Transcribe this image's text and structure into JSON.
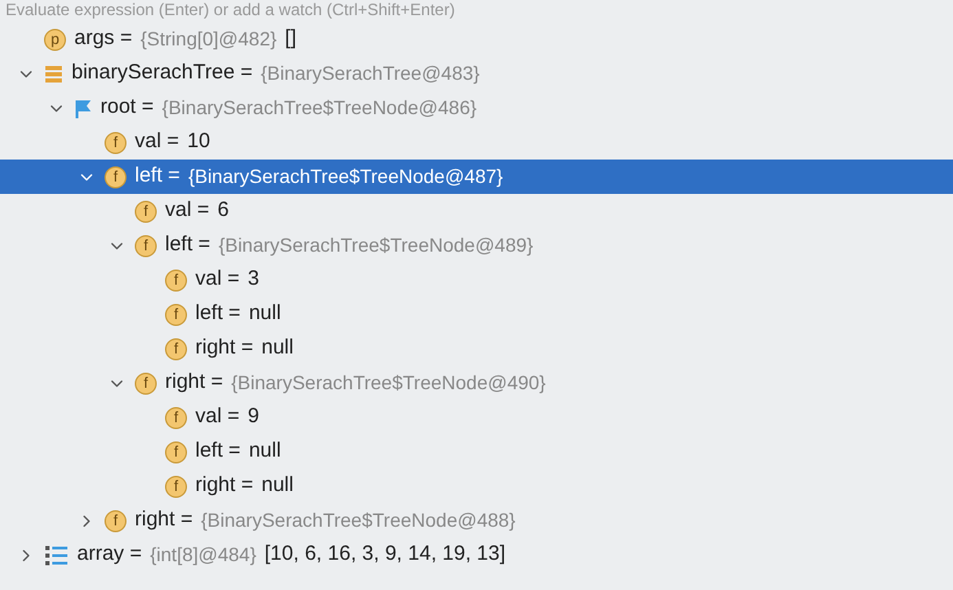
{
  "hint": "Evaluate expression (Enter) or add a watch (Ctrl+Shift+Enter)",
  "variables": [
    {
      "kind": "param",
      "badge": "p",
      "name": "args =",
      "type": "{String[0]@482}",
      "value": "[]",
      "selected": false
    },
    {
      "kind": "object",
      "name": "binarySerachTree =",
      "type": "{BinarySerachTree@483}",
      "expanded": true,
      "selected": false,
      "children": [
        {
          "kind": "flag",
          "name": "root =",
          "type": "{BinarySerachTree$TreeNode@486}",
          "expanded": true,
          "selected": false,
          "children": [
            {
              "kind": "field",
              "badge": "f",
              "name": "val =",
              "value": "10",
              "selected": false
            },
            {
              "kind": "field",
              "badge": "f",
              "name": "left =",
              "type": "{BinarySerachTree$TreeNode@487}",
              "expanded": true,
              "selected": true,
              "children": [
                {
                  "kind": "field",
                  "badge": "f",
                  "name": "val =",
                  "value": "6",
                  "selected": false
                },
                {
                  "kind": "field",
                  "badge": "f",
                  "name": "left =",
                  "type": "{BinarySerachTree$TreeNode@489}",
                  "expanded": true,
                  "selected": false,
                  "children": [
                    {
                      "kind": "field",
                      "badge": "f",
                      "name": "val =",
                      "value": "3",
                      "selected": false
                    },
                    {
                      "kind": "field",
                      "badge": "f",
                      "name": "left =",
                      "value": "null",
                      "selected": false
                    },
                    {
                      "kind": "field",
                      "badge": "f",
                      "name": "right =",
                      "value": "null",
                      "selected": false
                    }
                  ]
                },
                {
                  "kind": "field",
                  "badge": "f",
                  "name": "right =",
                  "type": "{BinarySerachTree$TreeNode@490}",
                  "expanded": true,
                  "selected": false,
                  "children": [
                    {
                      "kind": "field",
                      "badge": "f",
                      "name": "val =",
                      "value": "9",
                      "selected": false
                    },
                    {
                      "kind": "field",
                      "badge": "f",
                      "name": "left =",
                      "value": "null",
                      "selected": false
                    },
                    {
                      "kind": "field",
                      "badge": "f",
                      "name": "right =",
                      "value": "null",
                      "selected": false
                    }
                  ]
                }
              ]
            },
            {
              "kind": "field",
              "badge": "f",
              "name": "right =",
              "type": "{BinarySerachTree$TreeNode@488}",
              "expanded": false,
              "selected": false
            }
          ]
        }
      ]
    },
    {
      "kind": "array",
      "name": "array =",
      "type": "{int[8]@484}",
      "value": "[10, 6, 16, 3, 9, 14, 19, 13]",
      "expanded": false,
      "selected": false
    }
  ]
}
